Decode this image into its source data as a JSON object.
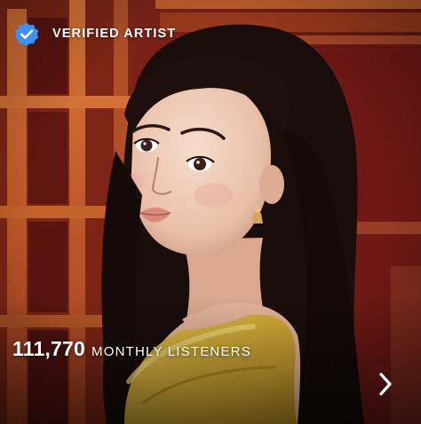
{
  "artist_card": {
    "verified_label": "VERIFIED ARTIST",
    "monthly_listeners_count": "111,770",
    "monthly_listeners_label": "MONTHLY LISTENERS"
  },
  "icons": {
    "verified": "verified-badge-icon",
    "next": "chevron-right-icon"
  },
  "colors": {
    "verified_badge": "#3d91f4",
    "text": "#ffffff",
    "background_red": "#6b1a14",
    "hair": "#1a0d0c",
    "dress_yellow": "#d9b23a"
  }
}
